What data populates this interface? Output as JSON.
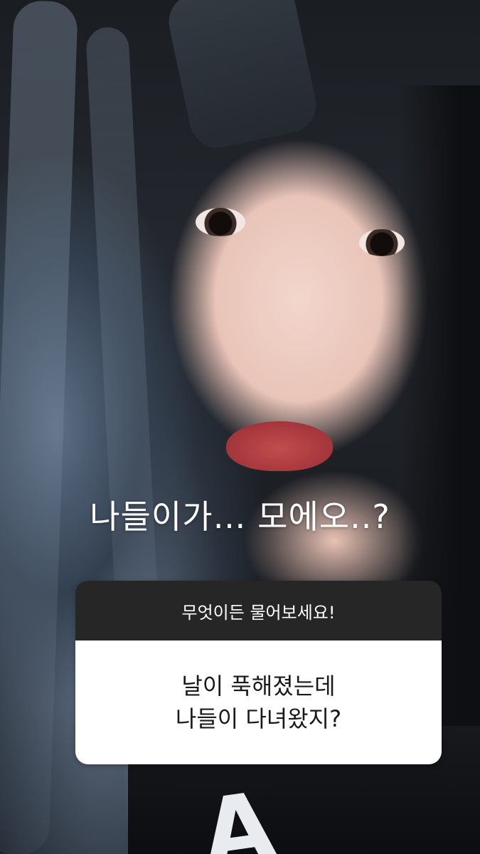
{
  "story": {
    "caption": "나들이가… 모에오..?",
    "question_sticker": {
      "prompt": "무엇이든 물어보세요!",
      "answer_lines": [
        "날이 푹해졌는데",
        "나들이 다녀왔지?"
      ]
    }
  },
  "colors": {
    "sticker_header_bg": "#262626",
    "sticker_body_bg": "#ffffff",
    "caption_text": "#ffffff"
  }
}
